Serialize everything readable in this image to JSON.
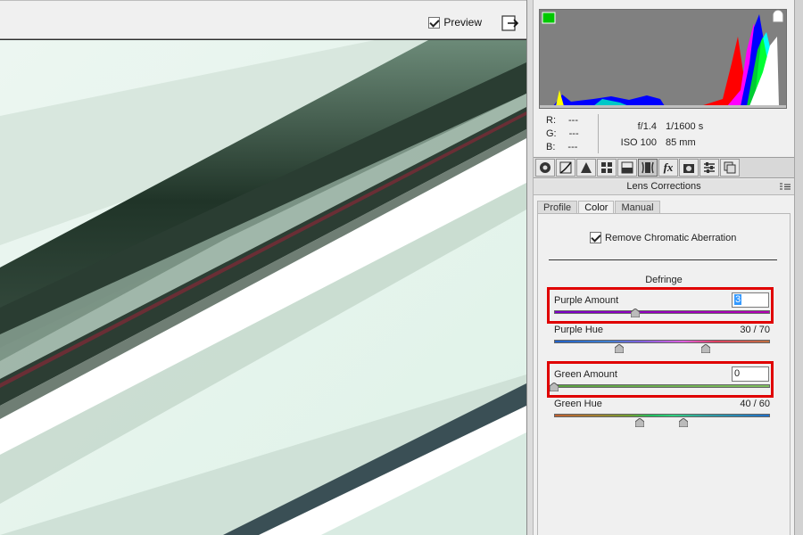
{
  "toolbar": {
    "preview_label": "Preview",
    "preview_checked": true
  },
  "info": {
    "r_label": "R:",
    "r_value": "---",
    "g_label": "G:",
    "g_value": "---",
    "b_label": "B:",
    "b_value": "---",
    "aperture": "f/1.4",
    "shutter": "1/1600 s",
    "iso": "ISO 100",
    "focal": "85 mm"
  },
  "panel_tabs": [
    {
      "icon": "basic-aperture-icon"
    },
    {
      "icon": "tone-curve-icon"
    },
    {
      "icon": "detail-mountain-icon"
    },
    {
      "icon": "hsl-icon"
    },
    {
      "icon": "split-toning-icon"
    },
    {
      "icon": "lens-corrections-icon",
      "active": true
    },
    {
      "icon": "fx-effects-icon"
    },
    {
      "icon": "camera-calibration-icon"
    },
    {
      "icon": "presets-icon"
    },
    {
      "icon": "snapshots-icon"
    }
  ],
  "section": {
    "title": "Lens Corrections"
  },
  "subtabs": [
    "Profile",
    "Color",
    "Manual"
  ],
  "active_subtab": "Color",
  "color": {
    "remove_ca_label": "Remove Chromatic Aberration",
    "remove_ca_checked": true,
    "defringe_label": "Defringe",
    "purple_amount_label": "Purple Amount",
    "purple_amount_value": "3",
    "purple_amount_fraction": 0.375,
    "purple_hue_label": "Purple Hue",
    "purple_hue_value": "30 / 70",
    "green_amount_label": "Green Amount",
    "green_amount_value": "0",
    "green_hue_label": "Green Hue",
    "green_hue_value": "40 / 60"
  },
  "colors": {
    "highlight": "#e00000",
    "selection": "#3399ff"
  }
}
